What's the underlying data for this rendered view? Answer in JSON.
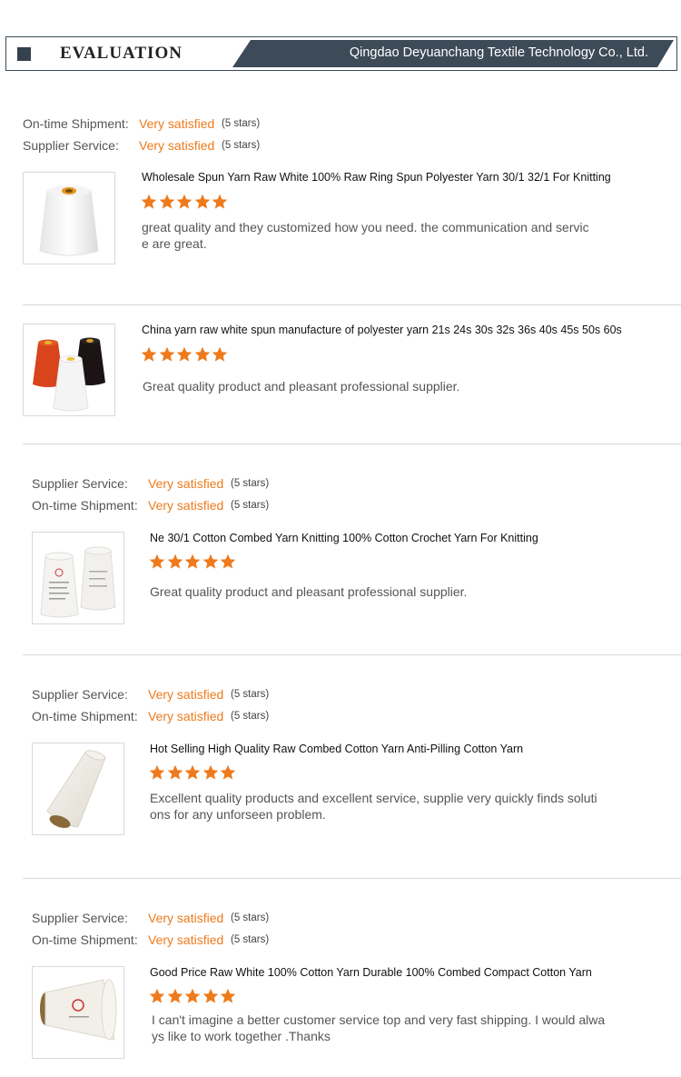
{
  "header": {
    "title": "EVALUATION",
    "company": "Qingdao Deyuanchang Textile Technology Co., Ltd.",
    "band_color": "#3d4a57"
  },
  "accent_color": "#ee7a1c",
  "reviews": [
    {
      "ratings": [
        {
          "label": "On-time Shipment:",
          "value": "Very satisfied",
          "stars": "(5 stars)"
        },
        {
          "label": "Supplier Service:",
          "value": "Very satisfied",
          "stars": "(5 stars)"
        }
      ],
      "product_title": "Wholesale Spun Yarn Raw White 100% Raw Ring Spun Polyester Yarn 30/1 32/1 For Knitting",
      "rating": 5,
      "comment": "great quality and they customized how you need. the communication and service are great.",
      "image": "white-yarn-cone-image"
    },
    {
      "ratings": [],
      "product_title": "China yarn raw white spun manufacture of polyester yarn 21s 24s 30s 32s 36s 40s 45s 50s 60s",
      "rating": 5,
      "comment": "Great quality product and pleasant professional supplier.",
      "image": "colored-yarn-cones-image"
    },
    {
      "ratings": [
        {
          "label": "Supplier Service:",
          "value": "Very satisfied",
          "stars": "(5 stars)"
        },
        {
          "label": "On-time Shipment:",
          "value": "Very satisfied",
          "stars": "(5 stars)"
        }
      ],
      "product_title": "Ne 30/1 Cotton Combed Yarn Knitting 100% Cotton Crochet Yarn For Knitting",
      "rating": 5,
      "comment": "Great quality product and pleasant professional supplier.",
      "image": "cotton-yarn-cones-image"
    },
    {
      "ratings": [
        {
          "label": "Supplier Service:",
          "value": "Very satisfied",
          "stars": "(5 stars)"
        },
        {
          "label": "On-time Shipment:",
          "value": "Very satisfied",
          "stars": "(5 stars)"
        }
      ],
      "product_title": "Hot Selling High Quality Raw Combed Cotton Yarn Anti-Pilling Cotton Yarn",
      "rating": 5,
      "comment": "Excellent quality products and excellent service,  supplie very quickly finds solutions for any unforseen problem.",
      "image": "tilted-yarn-cone-image"
    },
    {
      "ratings": [
        {
          "label": "Supplier Service:",
          "value": "Very satisfied",
          "stars": "(5 stars)"
        },
        {
          "label": "On-time Shipment:",
          "value": "Very satisfied",
          "stars": "(5 stars)"
        }
      ],
      "product_title": "Good Price Raw White 100% Cotton Yarn Durable 100% Combed Compact Cotton Yarn",
      "rating": 5,
      "comment": "I can't imagine a better customer service top and very fast shipping.  I would always like to work together .Thanks",
      "image": "compact-yarn-cone-image"
    }
  ]
}
